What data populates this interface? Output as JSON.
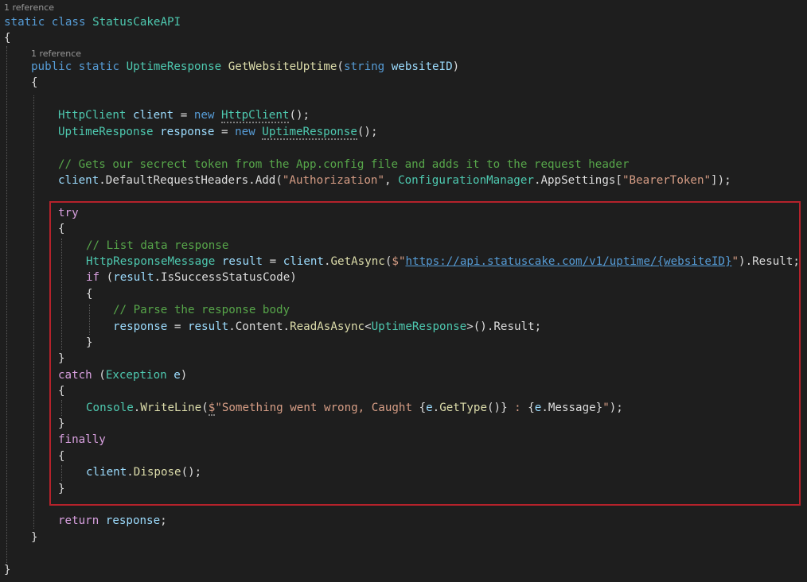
{
  "codelens": {
    "class_refs": "1 reference",
    "method_refs": "1 reference"
  },
  "code": {
    "l1": {
      "kw1": "static",
      "kw2": "class",
      "name": "StatusCakeAPI"
    },
    "l2": {
      "brace": "{"
    },
    "l3": {
      "kw1": "public",
      "kw2": "static",
      "type": "UptimeResponse",
      "method": "GetWebsiteUptime",
      "open": "(",
      "ptype": "string",
      "param": "websiteID",
      "close": ")"
    },
    "l4": {
      "brace": "{"
    },
    "l5": {
      "type1": "HttpClient",
      "var": "client",
      "eq": " = ",
      "kw": "new",
      "type2": "HttpClient",
      "end": "();"
    },
    "l6": {
      "type1": "UptimeResponse",
      "var": "response",
      "eq": " = ",
      "kw": "new",
      "type2": "UptimeResponse",
      "end": "();"
    },
    "l7": {
      "comment": "// Gets our secrect token from the App.config file and adds it to the request header"
    },
    "l8": {
      "var": "client",
      "p1": ".DefaultRequestHeaders.Add(",
      "s1": "\"Authorization\"",
      "p2": ", ",
      "type": "ConfigurationManager",
      "p3": ".AppSettings[",
      "s2": "\"BearerToken\"",
      "p4": "]);"
    },
    "l9": {
      "kw": "try"
    },
    "l10": {
      "brace": "{"
    },
    "l11": {
      "comment": "// List data response"
    },
    "l12": {
      "type": "HttpResponseMessage",
      "var1": "result",
      "eq": " = ",
      "var2": "client",
      "dot": ".",
      "method": "GetAsync",
      "open": "(",
      "dollar": "$\"",
      "url": "https://api.statuscake.com/v1/uptime/{websiteID}",
      "q": "\"",
      "end": ").Result;"
    },
    "l13": {
      "kw": "if",
      "open": " (",
      "var": "result",
      "rest": ".IsSuccessStatusCode)"
    },
    "l14": {
      "brace": "{"
    },
    "l15": {
      "comment": "// Parse the response body"
    },
    "l16": {
      "var1": "response",
      "eq": " = ",
      "var2": "result",
      "p1": ".Content.",
      "method": "ReadAsAsync",
      "lt": "<",
      "type": "UptimeResponse",
      "gt": ">().Result;"
    },
    "l17": {
      "brace": "}"
    },
    "l18": {
      "brace": "}"
    },
    "l19": {
      "kw": "catch",
      "open": " (",
      "type": "Exception",
      "sp": " ",
      "var": "e",
      "close": ")"
    },
    "l20": {
      "brace": "{"
    },
    "l21": {
      "type": "Console",
      "dot": ".",
      "method": "WriteLine",
      "open": "(",
      "dollar": "$",
      "s1": "\"Something went wrong, Caught ",
      "i1": "{",
      "var1": "e",
      "i2": ".",
      "m2": "GetType",
      "i3": "()}",
      "s2": " : ",
      "i4": "{",
      "var2": "e",
      "i5": ".Message}",
      "s3": "\"",
      "end": ");"
    },
    "l22": {
      "brace": "}"
    },
    "l23": {
      "kw": "finally"
    },
    "l24": {
      "brace": "{"
    },
    "l25": {
      "var": "client",
      "dot": ".",
      "method": "Dispose",
      "end": "();"
    },
    "l26": {
      "brace": "}"
    },
    "l27": {
      "kw": "return",
      "sp": " ",
      "var": "response",
      "end": ";"
    },
    "l28": {
      "brace": "}"
    },
    "l29": {
      "brace": "}"
    }
  },
  "colors": {
    "background": "#1e1e1e",
    "keyword": "#569cd6",
    "control": "#d8a0df",
    "type": "#4ec9b0",
    "method": "#dcdcaa",
    "variable": "#9cdcfe",
    "string": "#d69d85",
    "comment": "#57a64a",
    "highlight": "#b5222b"
  }
}
